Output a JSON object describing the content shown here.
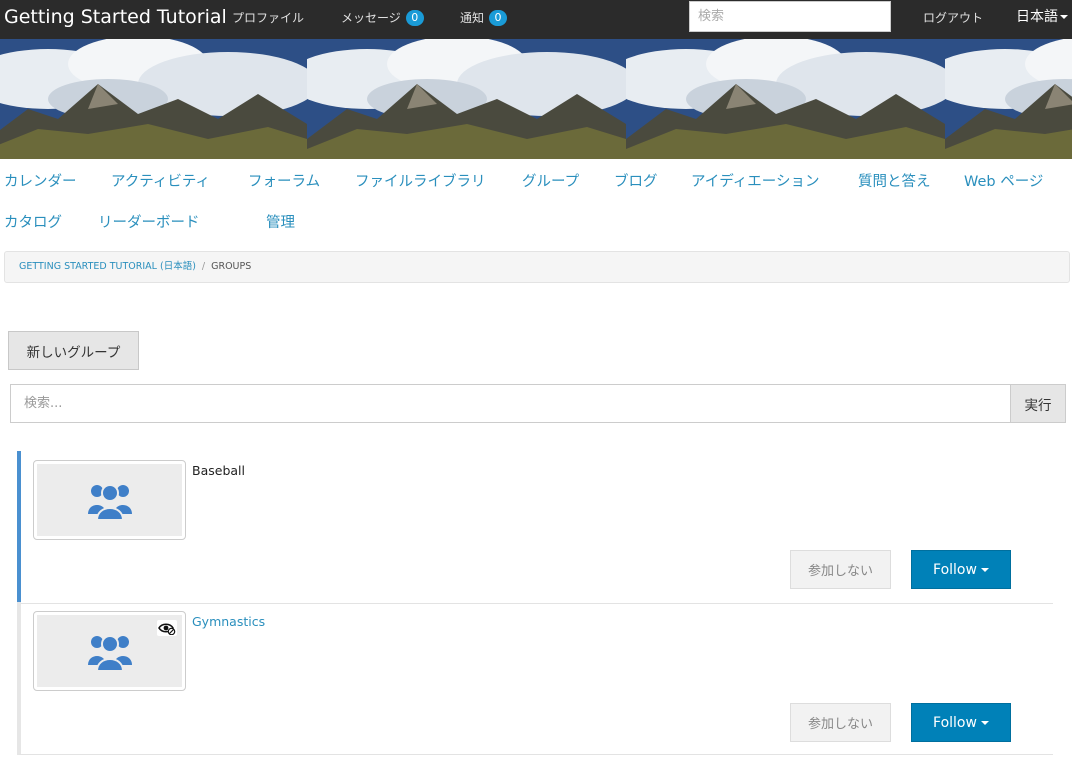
{
  "topbar": {
    "brand": "Getting Started Tutorial",
    "profile": "プロファイル",
    "messages": "メッセージ",
    "messages_count": "0",
    "notifications": "通知",
    "notifications_count": "0",
    "search_placeholder": "検索",
    "logout": "ログアウト",
    "language": "日本語"
  },
  "nav": {
    "items": [
      "カレンダー",
      "アクティビティ",
      "フォーラム",
      "ファイルライブラリ",
      "グループ",
      "ブログ",
      "アイディエーション",
      "質問と答え",
      "Web ページ",
      "カタログ",
      "リーダーボード",
      "管理"
    ]
  },
  "breadcrumb": {
    "home": "GETTING STARTED TUTORIAL (日本語)",
    "separator": "/",
    "current": "GROUPS"
  },
  "actions": {
    "new_group": "新しいグループ"
  },
  "search": {
    "placeholder": "検索...",
    "submit": "実行"
  },
  "groups": [
    {
      "name": "Baseball",
      "decline": "参加しない",
      "follow": "Follow",
      "name_color": "#222222",
      "private_icon": false
    },
    {
      "name": "Gymnastics",
      "decline": "参加しない",
      "follow": "Follow",
      "name_color": "#2a8fbd",
      "private_icon": true
    }
  ],
  "colors": {
    "accent": "#2a8fbd",
    "follow_button": "#0081b8",
    "badge": "#1a9bd7",
    "active_border": "#4a90d0",
    "group_icon": "#3f7fc8"
  }
}
